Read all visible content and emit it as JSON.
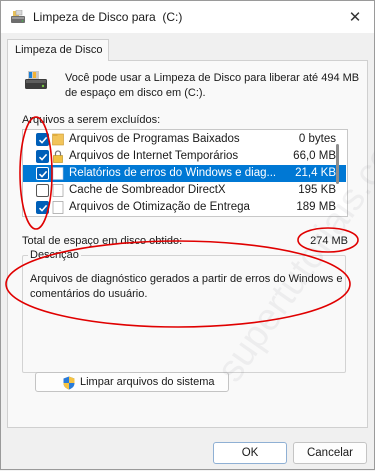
{
  "window": {
    "title": "Limpeza de Disco para  (C:)",
    "close_glyph": "✕"
  },
  "tab": {
    "label": "Limpeza de Disco"
  },
  "intro": {
    "text": "Você pode usar a Limpeza de Disco para liberar até 494 MB de espaço em disco em  (C:).",
    "icon": "drive-icon"
  },
  "files": {
    "label": "Arquivos a serem excluídos:",
    "items": [
      {
        "name": "Arquivos de Programas Baixados",
        "size": "0 bytes",
        "checked": true,
        "selected": false,
        "icon": "folder-icon"
      },
      {
        "name": "Arquivos de Internet Temporários",
        "size": "66,0 MB",
        "checked": true,
        "selected": false,
        "icon": "lock-icon"
      },
      {
        "name": "Relatórios de erros do Windows e diag...",
        "size": "21,4 KB",
        "checked": true,
        "selected": true,
        "icon": "file-icon"
      },
      {
        "name": "Cache de Sombreador DirectX",
        "size": "195 KB",
        "checked": false,
        "selected": false,
        "icon": "file-icon"
      },
      {
        "name": "Arquivos de Otimização de Entrega",
        "size": "189 MB",
        "checked": true,
        "selected": false,
        "icon": "file-icon"
      }
    ]
  },
  "total": {
    "label": "Total de espaço em disco obtido:",
    "value": "274 MB"
  },
  "description": {
    "legend": "Descrição",
    "text": "Arquivos de diagnóstico gerados a partir de erros do Windows e comentários do usuário."
  },
  "buttons": {
    "system_cleanup": "Limpar arquivos do sistema",
    "ok": "OK",
    "cancel": "Cancelar"
  },
  "colors": {
    "accent": "#005fb8",
    "selection": "#0078d4",
    "annotation": "#e00000"
  },
  "watermark": "supertutoriais.com.br"
}
